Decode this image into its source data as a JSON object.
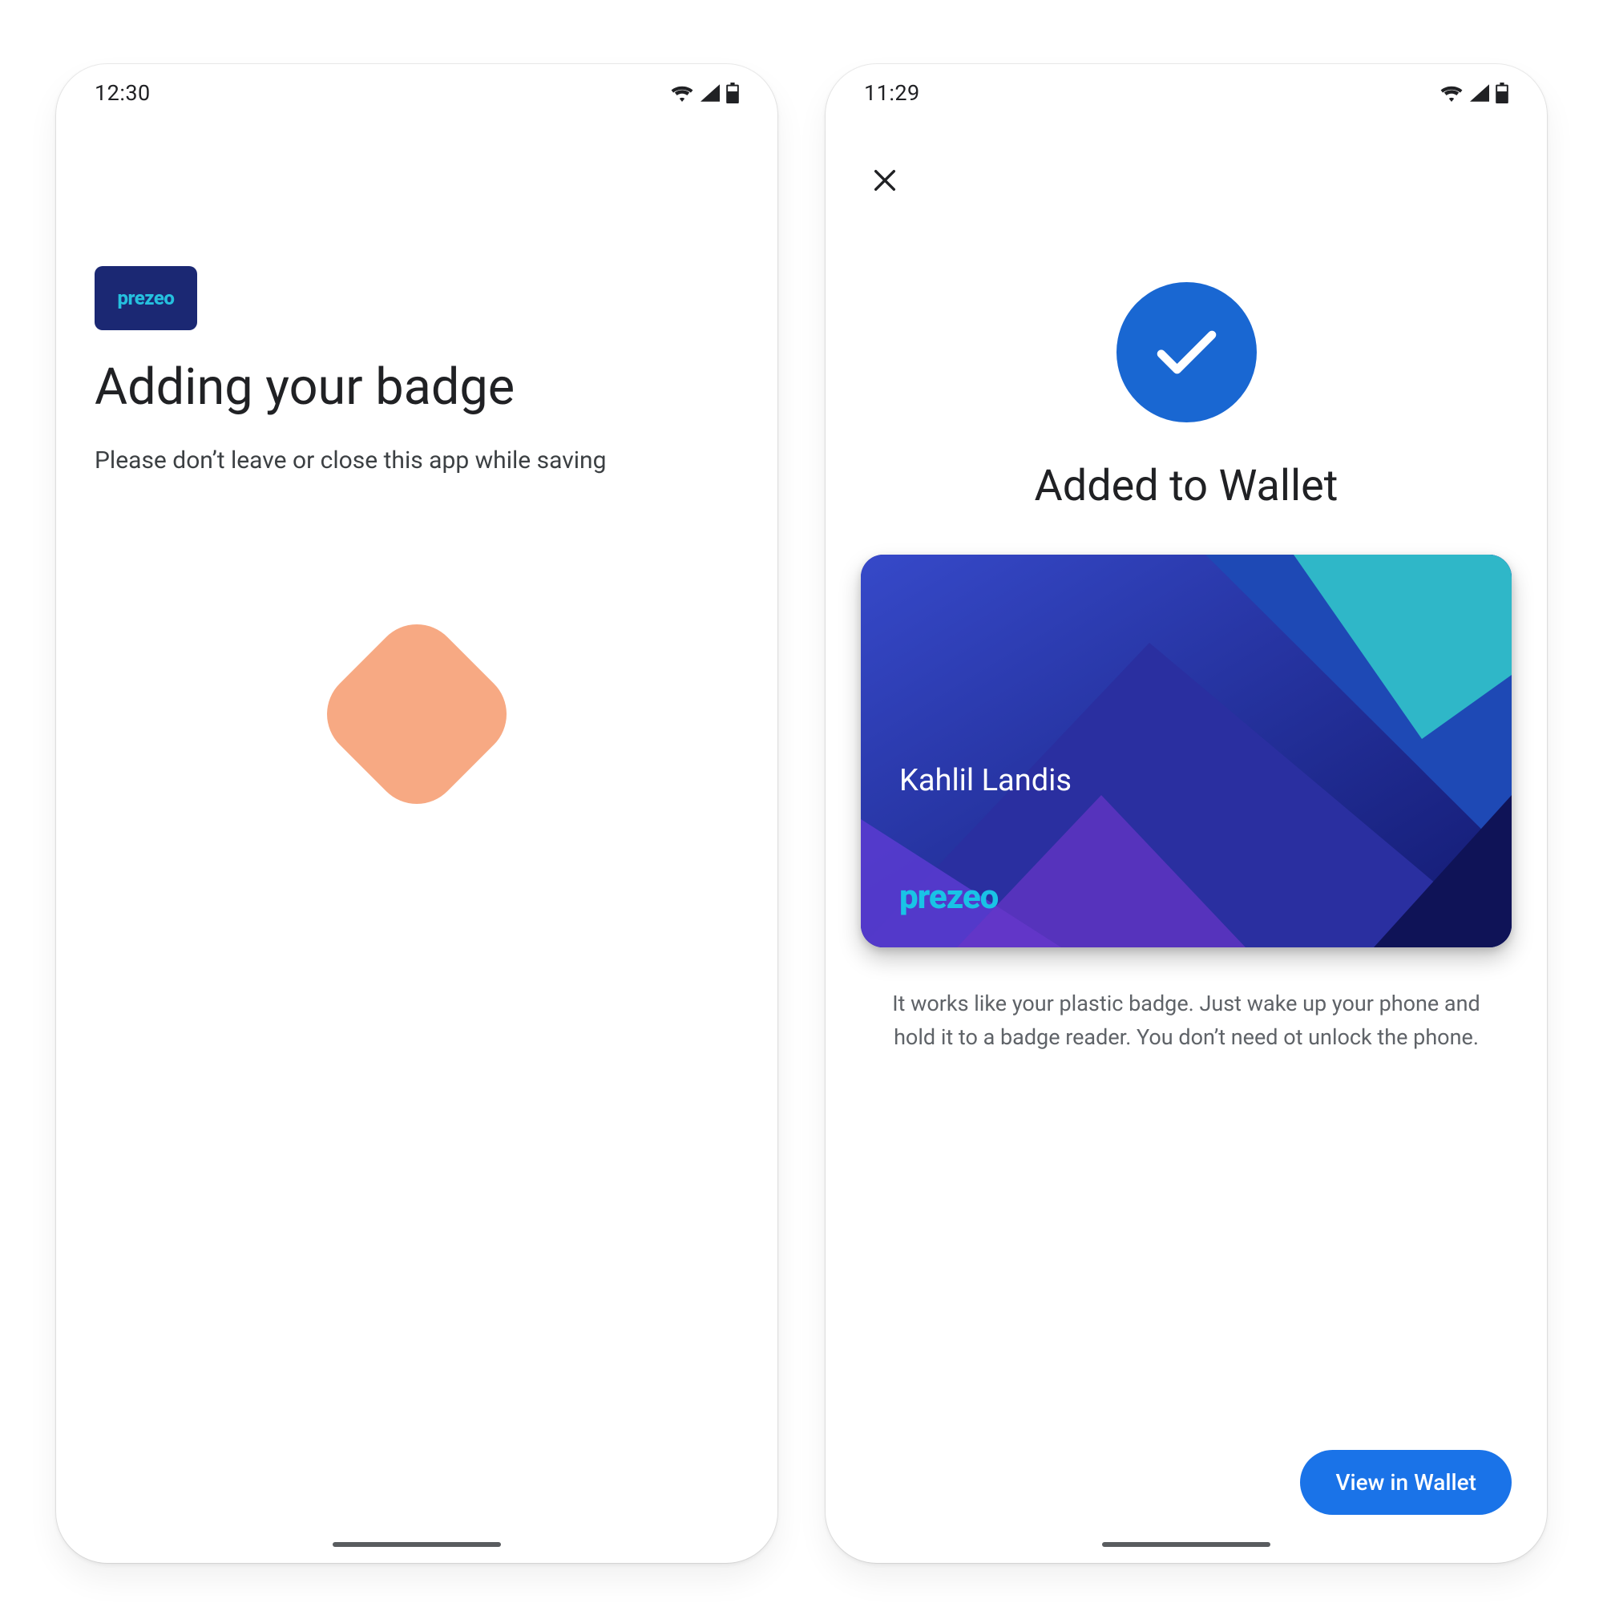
{
  "screens": {
    "loading": {
      "status_time": "12:30",
      "brand": "prezeo",
      "title": "Adding your badge",
      "subtitle": "Please don’t leave or close this app while saving"
    },
    "success": {
      "status_time": "11:29",
      "title": "Added to Wallet",
      "card": {
        "holder_name": "Kahlil Landis",
        "brand": "prezeo"
      },
      "description": "It works like your plastic badge. Just wake up your phone and hold it to a badge reader. You don’t need ot unlock the phone.",
      "cta_label": "View in Wallet"
    }
  },
  "colors": {
    "primary": "#1a73e8",
    "brand_bg": "#1b2873",
    "brand_fg": "#25c0de",
    "spinner": "#f7a983"
  }
}
